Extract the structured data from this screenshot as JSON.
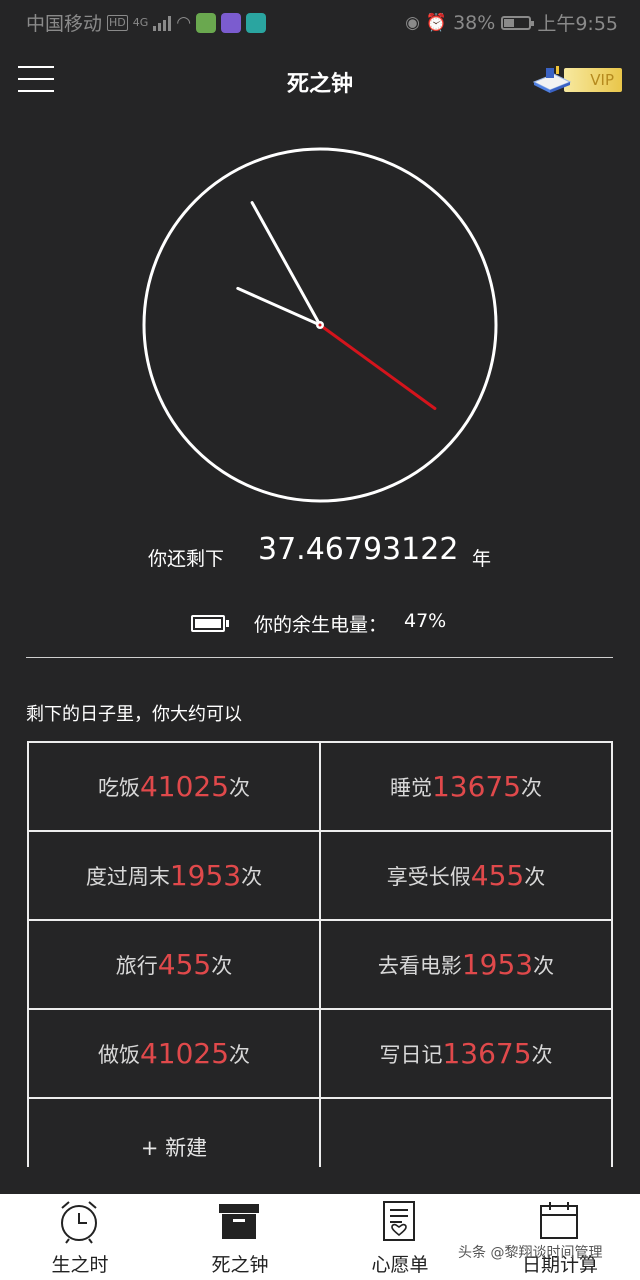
{
  "status_bar": {
    "carrier": "中国移动",
    "hd": "HD",
    "network": "4G",
    "battery_percent": "38%",
    "time": "上午9:55"
  },
  "header": {
    "title": "死之钟",
    "vip_label": "VIP"
  },
  "clock": {
    "hour_hand_angle_deg": -66,
    "minute_hand_angle_deg": -29,
    "second_hand_angle_deg": 126
  },
  "remaining": {
    "prefix": "你还剩下",
    "value": "37.46793122",
    "unit": "年"
  },
  "life_power": {
    "label": "你的余生电量：",
    "value": "47%"
  },
  "section_title": "剩下的日子里，你大约可以",
  "activities": [
    {
      "label": "吃饭",
      "count": "41025",
      "suffix": "次"
    },
    {
      "label": "睡觉",
      "count": "13675",
      "suffix": "次"
    },
    {
      "label": "度过周末",
      "count": "1953",
      "suffix": "次"
    },
    {
      "label": "享受长假",
      "count": "455",
      "suffix": "次"
    },
    {
      "label": "旅行",
      "count": "455",
      "suffix": "次"
    },
    {
      "label": "去看电影",
      "count": "1953",
      "suffix": "次"
    },
    {
      "label": "做饭",
      "count": "41025",
      "suffix": "次"
    },
    {
      "label": "写日记",
      "count": "13675",
      "suffix": "次"
    }
  ],
  "new_button": "+ 新建",
  "nav": {
    "items": [
      {
        "label": "生之时",
        "icon": "alarm-clock-icon"
      },
      {
        "label": "死之钟",
        "icon": "box-icon"
      },
      {
        "label": "心愿单",
        "icon": "wishlist-icon"
      },
      {
        "label": "日期计算",
        "icon": "calendar-icon"
      }
    ]
  },
  "watermark": "头条 @黎翔谈时间管理",
  "colors": {
    "background": "#252526",
    "accent_red": "#e0494b",
    "second_hand": "#d4141c"
  }
}
